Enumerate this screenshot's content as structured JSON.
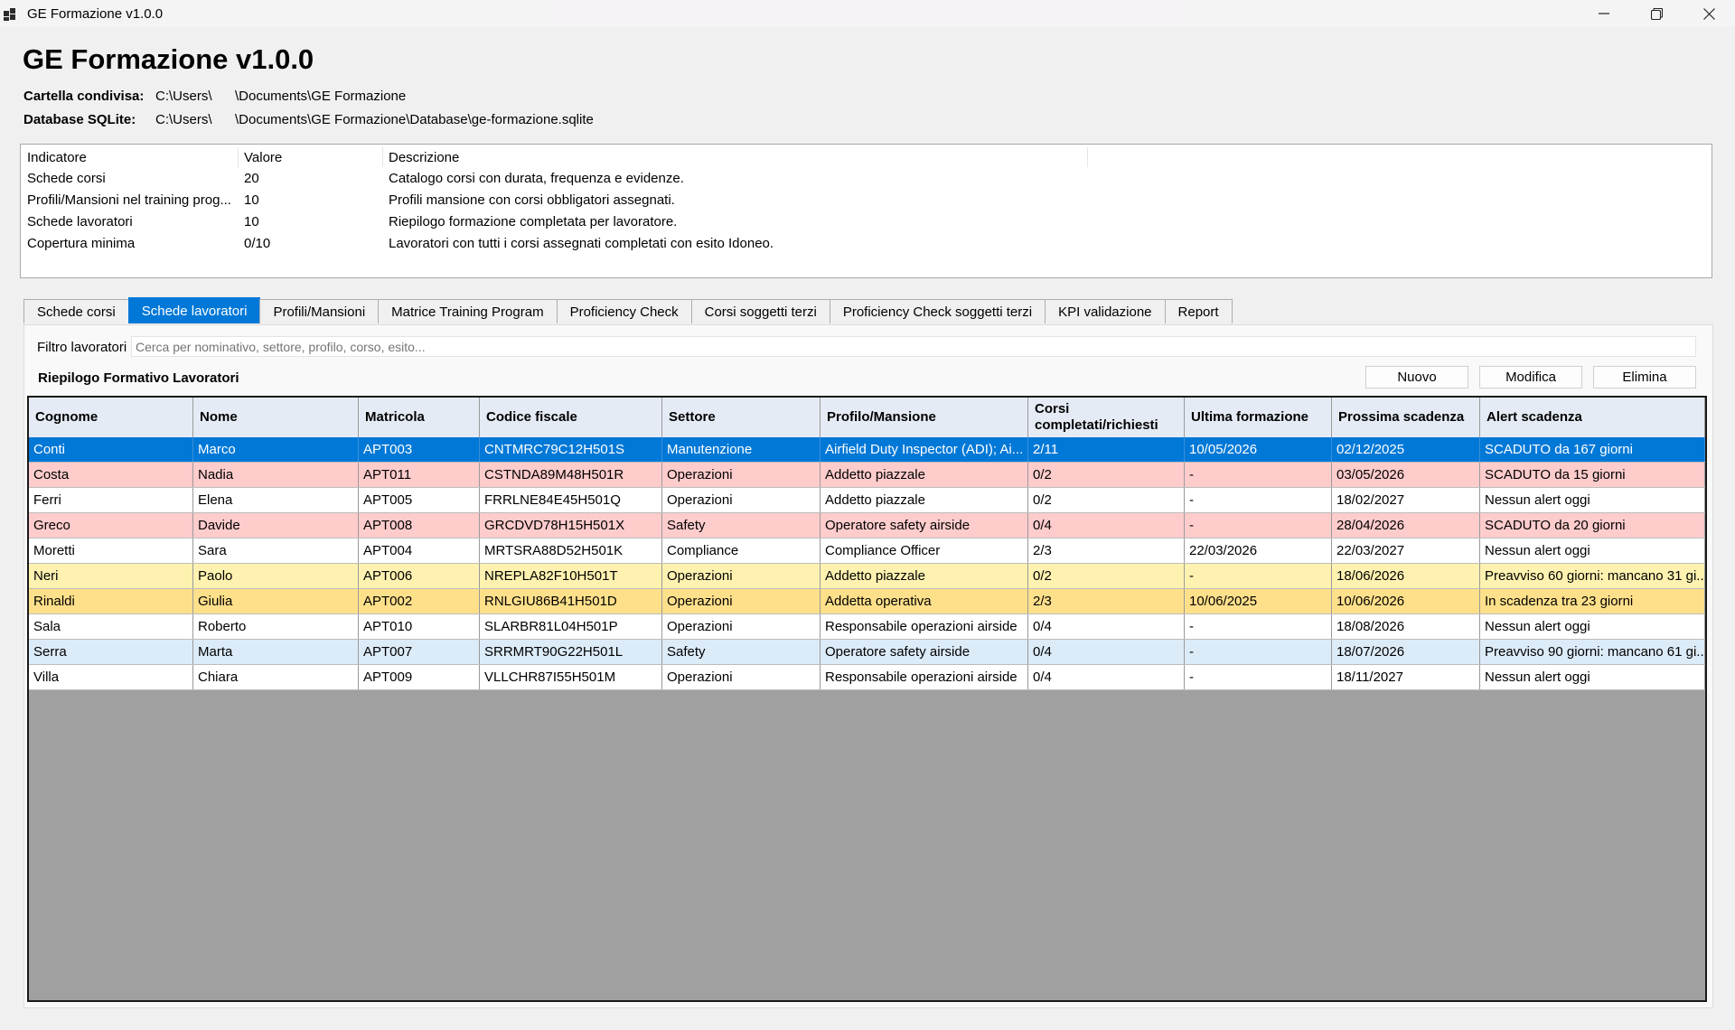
{
  "window": {
    "title": "GE Formazione v1.0.0",
    "minimize_icon": "minimize-icon",
    "maximize_icon": "restore-icon",
    "close_icon": "close-icon"
  },
  "header": {
    "title": "GE Formazione v1.0.0",
    "shared_folder_label": "Cartella condivisa:",
    "shared_folder_prefix": "C:\\Users\\",
    "shared_folder_suffix": "\\Documents\\GE Formazione",
    "db_label": "Database SQLite:",
    "db_prefix": "C:\\Users\\",
    "db_suffix": "\\Documents\\GE Formazione\\Database\\ge-formazione.sqlite"
  },
  "indicators": {
    "headers": [
      "Indicatore",
      "Valore",
      "Descrizione"
    ],
    "rows": [
      {
        "name": "Schede corsi",
        "value": "20",
        "desc": "Catalogo corsi con durata, frequenza e evidenze."
      },
      {
        "name": "Profili/Mansioni nel training prog...",
        "value": "10",
        "desc": "Profili mansione con corsi obbligatori assegnati."
      },
      {
        "name": "Schede lavoratori",
        "value": "10",
        "desc": "Riepilogo formazione completata per lavoratore."
      },
      {
        "name": "Copertura minima",
        "value": "0/10",
        "desc": "Lavoratori con tutti i corsi assegnati completati con esito Idoneo."
      }
    ]
  },
  "tabs": [
    {
      "label": "Schede corsi",
      "active": false
    },
    {
      "label": "Schede lavoratori",
      "active": true
    },
    {
      "label": "Profili/Mansioni",
      "active": false
    },
    {
      "label": "Matrice Training Program",
      "active": false
    },
    {
      "label": "Proficiency Check",
      "active": false
    },
    {
      "label": "Corsi soggetti terzi",
      "active": false
    },
    {
      "label": "Proficiency Check soggetti terzi",
      "active": false
    },
    {
      "label": "KPI validazione",
      "active": false
    },
    {
      "label": "Report",
      "active": false
    }
  ],
  "workers": {
    "filter_label": "Filtro lavoratori",
    "filter_placeholder": "Cerca per nominativo, settore, profilo, corso, esito...",
    "section_title": "Riepilogo Formativo Lavoratori",
    "buttons": {
      "new": "Nuovo",
      "edit": "Modifica",
      "delete": "Elimina"
    },
    "columns": [
      "Cognome",
      "Nome",
      "Matricola",
      "Codice fiscale",
      "Settore",
      "Profilo/Mansione",
      "Corsi completati/richiesti",
      "Ultima formazione",
      "Prossima scadenza",
      "Alert scadenza"
    ],
    "row_colors": {
      "selected": "#0078d7",
      "expired": "#ffcccc",
      "warning": "#fff2b0",
      "soon": "#ffe08a",
      "notice90": "#dcebf8",
      "normal": "#ffffff"
    },
    "rows": [
      {
        "status": "selected",
        "cells": [
          "Conti",
          "Marco",
          "APT003",
          "CNTMRC79C12H501S",
          "Manutenzione",
          "Airfield Duty Inspector (ADI); Ai...",
          "2/11",
          "10/05/2026",
          "02/12/2025",
          "SCADUTO da 167 giorni"
        ]
      },
      {
        "status": "expired",
        "cells": [
          "Costa",
          "Nadia",
          "APT011",
          "CSTNDA89M48H501R",
          "Operazioni",
          "Addetto piazzale",
          "0/2",
          "-",
          "03/05/2026",
          "SCADUTO da 15 giorni"
        ]
      },
      {
        "status": "normal",
        "cells": [
          "Ferri",
          "Elena",
          "APT005",
          "FRRLNE84E45H501Q",
          "Operazioni",
          "Addetto piazzale",
          "0/2",
          "-",
          "18/02/2027",
          "Nessun alert oggi"
        ]
      },
      {
        "status": "expired",
        "cells": [
          "Greco",
          "Davide",
          "APT008",
          "GRCDVD78H15H501X",
          "Safety",
          "Operatore safety airside",
          "0/4",
          "-",
          "28/04/2026",
          "SCADUTO da 20 giorni"
        ]
      },
      {
        "status": "normal",
        "cells": [
          "Moretti",
          "Sara",
          "APT004",
          "MRTSRA88D52H501K",
          "Compliance",
          "Compliance Officer",
          "2/3",
          "22/03/2026",
          "22/03/2027",
          "Nessun alert oggi"
        ]
      },
      {
        "status": "warning",
        "cells": [
          "Neri",
          "Paolo",
          "APT006",
          "NREPLA82F10H501T",
          "Operazioni",
          "Addetto piazzale",
          "0/2",
          "-",
          "18/06/2026",
          "Preavviso 60 giorni: mancano 31 gi..."
        ]
      },
      {
        "status": "soon",
        "cells": [
          "Rinaldi",
          "Giulia",
          "APT002",
          "RNLGIU86B41H501D",
          "Operazioni",
          "Addetta operativa",
          "2/3",
          "10/06/2025",
          "10/06/2026",
          "In scadenza tra 23 giorni"
        ]
      },
      {
        "status": "normal",
        "cells": [
          "Sala",
          "Roberto",
          "APT010",
          "SLARBR81L04H501P",
          "Operazioni",
          "Responsabile operazioni airside",
          "0/4",
          "-",
          "18/08/2026",
          "Nessun alert oggi"
        ]
      },
      {
        "status": "notice90",
        "cells": [
          "Serra",
          "Marta",
          "APT007",
          "SRRMRT90G22H501L",
          "Safety",
          "Operatore safety airside",
          "0/4",
          "-",
          "18/07/2026",
          "Preavviso 90 giorni: mancano 61 gi..."
        ]
      },
      {
        "status": "normal",
        "cells": [
          "Villa",
          "Chiara",
          "APT009",
          "VLLCHR87I55H501M",
          "Operazioni",
          "Responsabile operazioni airside",
          "0/4",
          "-",
          "18/11/2027",
          "Nessun alert oggi"
        ]
      }
    ]
  }
}
